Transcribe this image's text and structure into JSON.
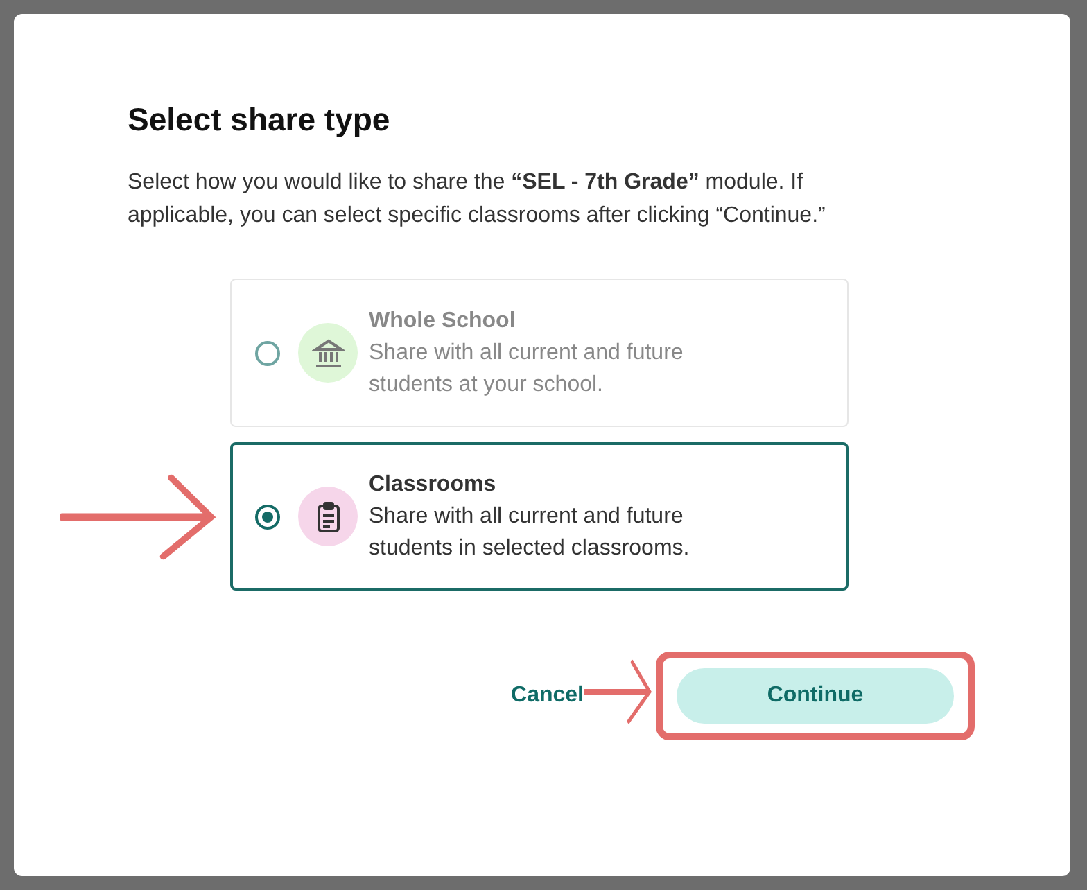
{
  "dialog": {
    "title": "Select share type",
    "description": "Select how you would like to share the **“SEL - 7th Grade”** module. If applicable, you can select specific classrooms after clicking “Continue.”",
    "options": [
      {
        "kind": "building",
        "title": "Whole School",
        "description": "Share with all current and future students at your school.",
        "selected": false,
        "color": "#dff7d8",
        "pointed": false
      },
      {
        "kind": "clipboard",
        "title": "Classrooms",
        "description": "Share with all current and future students in selected classrooms.",
        "selected": true,
        "color": "#f6d6ea",
        "pointed": true
      }
    ],
    "buttons": [
      {
        "kind": "link",
        "label": "Cancel",
        "highlighted": false,
        "pointed": false
      },
      {
        "kind": "primary",
        "label": "Continue",
        "highlighted": true,
        "pointed": true
      }
    ]
  }
}
